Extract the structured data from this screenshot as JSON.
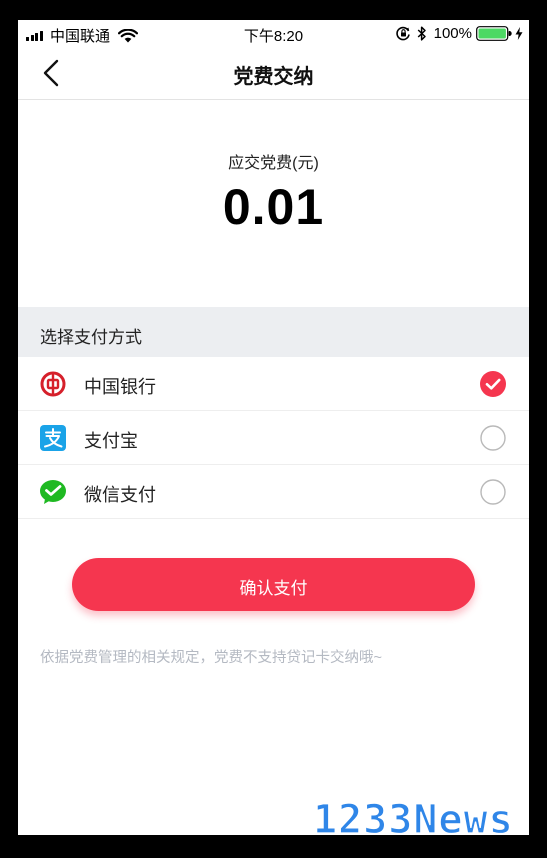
{
  "status_bar": {
    "carrier": "中国联通",
    "time": "下午8:20",
    "battery": "100%",
    "icons": [
      "signal-icon",
      "wifi-icon",
      "rotation-lock-icon",
      "bluetooth-icon",
      "battery-icon",
      "charging-icon"
    ]
  },
  "nav": {
    "title": "党费交纳",
    "back_icon": "chevron-left-icon"
  },
  "amount": {
    "label": "应交党费(元)",
    "value": "0.01"
  },
  "payment": {
    "section_title": "选择支付方式",
    "options": [
      {
        "label": "中国银行",
        "icon": "bank-of-china-icon",
        "selected": true
      },
      {
        "label": "支付宝",
        "icon": "alipay-icon",
        "selected": false
      },
      {
        "label": "微信支付",
        "icon": "wechat-pay-icon",
        "selected": false
      }
    ]
  },
  "confirm": {
    "label": "确认支付"
  },
  "notice": "依据党费管理的相关规定，党费不支持贷记卡交纳哦~",
  "watermark": "1233News",
  "colors": {
    "accent": "#f5364f",
    "section_bg": "#eceef1",
    "notice": "#b4b9c2",
    "alipay": "#1aa3e8",
    "wechat": "#1fb922",
    "boc": "#d6202b",
    "watermark": "#2f86e8"
  }
}
